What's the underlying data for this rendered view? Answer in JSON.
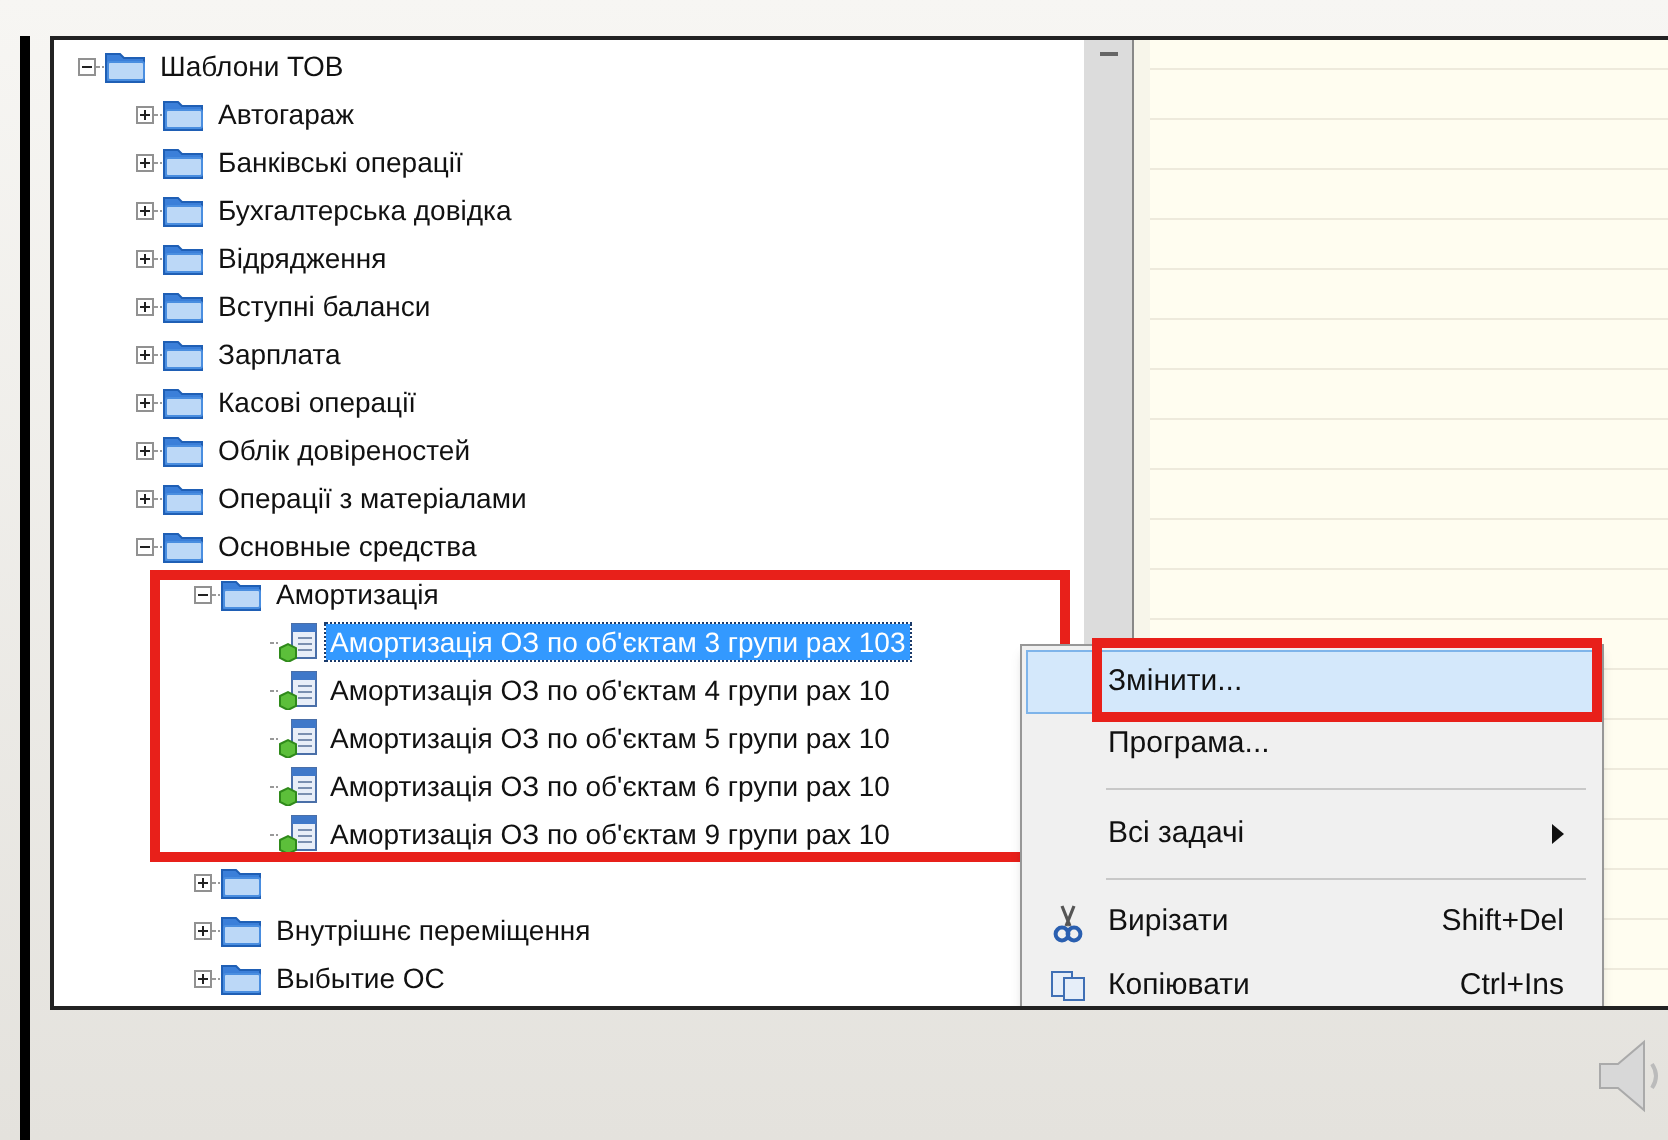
{
  "tree": [
    {
      "kind": "folder",
      "label": "Шаблони ТОВ",
      "expanded": true,
      "children": [
        {
          "kind": "folder",
          "label": "Автогараж",
          "expanded": false
        },
        {
          "kind": "folder",
          "label": "Банківські операції",
          "expanded": false
        },
        {
          "kind": "folder",
          "label": "Бухгалтерська довідка",
          "expanded": false
        },
        {
          "kind": "folder",
          "label": "Відрядження",
          "expanded": false
        },
        {
          "kind": "folder",
          "label": "Вступні баланси",
          "expanded": false
        },
        {
          "kind": "folder",
          "label": "Зарплата",
          "expanded": false
        },
        {
          "kind": "folder",
          "label": "Касові операції",
          "expanded": false
        },
        {
          "kind": "folder",
          "label": "Облік довіреностей",
          "expanded": false
        },
        {
          "kind": "folder",
          "label": "Операції з матеріалами",
          "expanded": false
        },
        {
          "kind": "folder",
          "label": "Основные средства",
          "expanded": true,
          "children": [
            {
              "kind": "folder",
              "label": "Амортизація",
              "expanded": true,
              "children": [
                {
                  "kind": "document",
                  "label": "Амортизація ОЗ по об'єктам 3 групи рах 103",
                  "selected": true
                },
                {
                  "kind": "document",
                  "label": "Амортизація ОЗ по об'єктам 4 групи рах 10",
                  "selected": false
                },
                {
                  "kind": "document",
                  "label": "Амортизація ОЗ по об'єктам 5 групи рах 10",
                  "selected": false
                },
                {
                  "kind": "document",
                  "label": "Амортизація ОЗ по об'єктам 6 групи рах 10",
                  "selected": false
                },
                {
                  "kind": "document",
                  "label": "Амортизація ОЗ по об'єктам 9 групи рах 10",
                  "selected": false
                }
              ]
            },
            {
              "kind": "folder",
              "expanded": false
            },
            {
              "kind": "folder",
              "label": "Внутрішнє переміщення",
              "expanded": false
            },
            {
              "kind": "folder",
              "label": "Выбытие ОС",
              "expanded": false
            }
          ]
        }
      ]
    }
  ],
  "context_menu": [
    {
      "kind": "item",
      "label": "Змінити...",
      "selected": true
    },
    {
      "kind": "item",
      "label": "Програма...",
      "selected": false
    },
    {
      "kind": "separator"
    },
    {
      "kind": "submenu",
      "label": "Всі задачі",
      "selected": false
    },
    {
      "kind": "separator"
    },
    {
      "kind": "item",
      "label": "Вирізати",
      "shortcut": "Shift+Del",
      "selected": false
    },
    {
      "kind": "item",
      "label": "Копіювати",
      "shortcut": "Ctrl+Ins",
      "selected": false
    }
  ]
}
